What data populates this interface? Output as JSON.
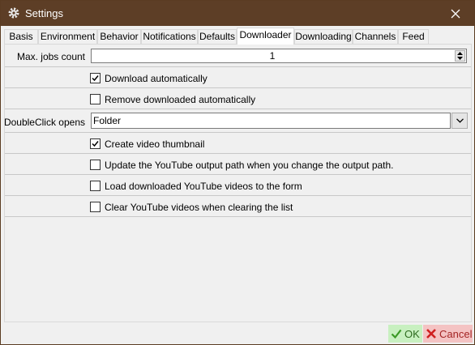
{
  "window": {
    "title": "Settings",
    "icon": "gear-icon"
  },
  "tabs": [
    {
      "label": "Basis"
    },
    {
      "label": "Environment"
    },
    {
      "label": "Behavior"
    },
    {
      "label": "Notifications"
    },
    {
      "label": "Defaults"
    },
    {
      "label": "Downloader",
      "active": true
    },
    {
      "label": "Downloading"
    },
    {
      "label": "Channels"
    },
    {
      "label": "Feed"
    }
  ],
  "downloader": {
    "max_jobs_label": "Max. jobs count",
    "max_jobs_value": "1",
    "download_auto": {
      "label": "Download automatically",
      "checked": true
    },
    "remove_downloaded": {
      "label": "Remove downloaded automatically",
      "checked": false
    },
    "doubleclick_label": "DoubleClick opens",
    "doubleclick_value": "Folder",
    "create_thumbnail": {
      "label": "Create video thumbnail",
      "checked": true
    },
    "update_yt_path": {
      "label": "Update the YouTube output path when you change the output path.",
      "checked": false
    },
    "load_yt_videos": {
      "label": "Load downloaded YouTube videos to the form",
      "checked": false
    },
    "clear_yt_videos": {
      "label": "Clear YouTube videos when clearing the list",
      "checked": false
    }
  },
  "buttons": {
    "ok": "OK",
    "cancel": "Cancel"
  },
  "colors": {
    "titlebar": "#5d3e26",
    "ok_bg": "#c8f0c0",
    "cancel_bg": "#f4c3c3"
  }
}
